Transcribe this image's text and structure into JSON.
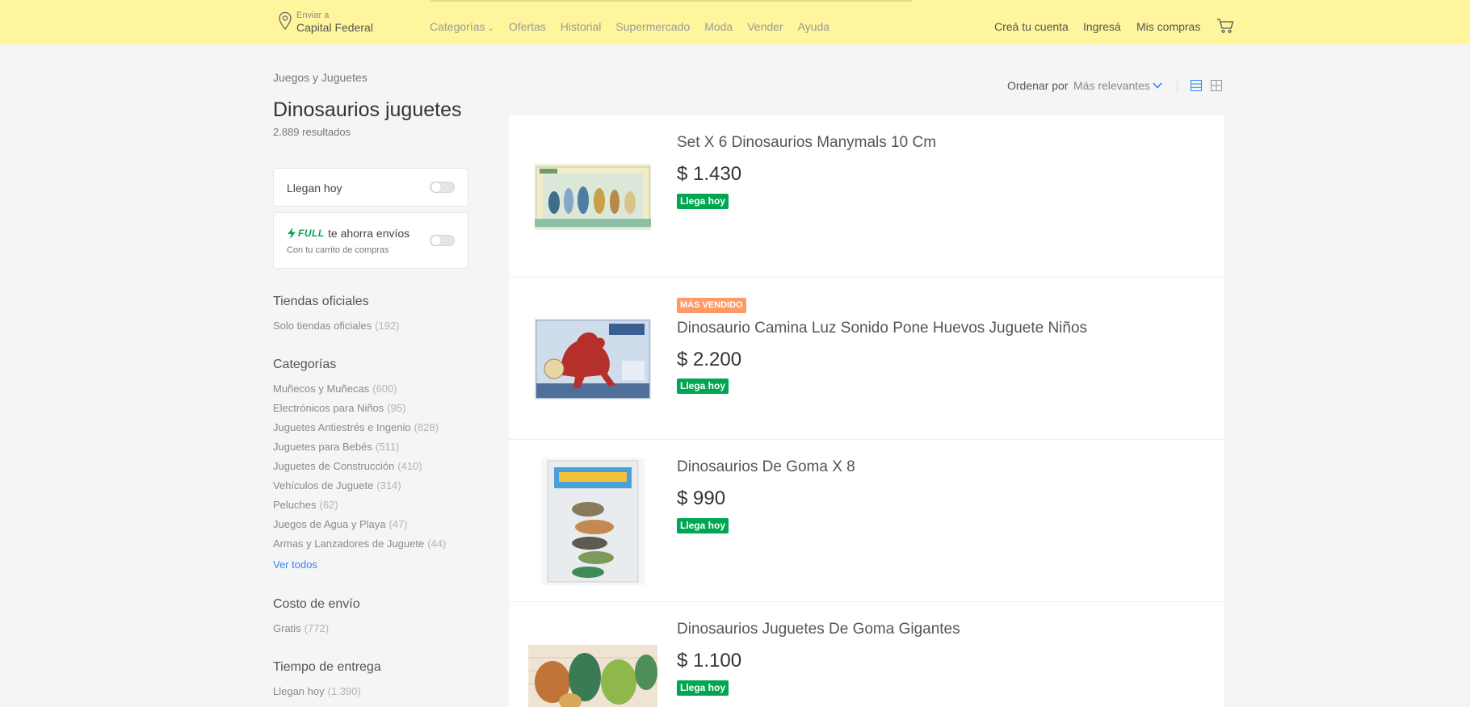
{
  "header": {
    "location_small": "Enviar a",
    "location_main": "Capital Federal",
    "nav": [
      "Categorías",
      "Ofertas",
      "Historial",
      "Supermercado",
      "Moda",
      "Vender",
      "Ayuda"
    ],
    "account": {
      "create": "Creá tu cuenta",
      "login": "Ingresá",
      "purchases": "Mis compras"
    }
  },
  "breadcrumb": "Juegos y Juguetes",
  "search": {
    "title": "Dinosaurios juguetes",
    "results": "2.889 resultados"
  },
  "filters": {
    "arrive_today": "Llegan hoy",
    "full_word": "FULL",
    "full_text": "te ahorra envíos",
    "full_sub": "Con tu carrito de compras",
    "official": {
      "title": "Tiendas oficiales",
      "label": "Solo tiendas oficiales",
      "count": "(192)"
    },
    "categories": {
      "title": "Categorías",
      "items": [
        {
          "label": "Muñecos y Muñecas",
          "count": "(600)"
        },
        {
          "label": "Electrónicos para Niños",
          "count": "(95)"
        },
        {
          "label": "Juguetes Antiestrés e Ingenio",
          "count": "(828)"
        },
        {
          "label": "Juguetes para Bebés",
          "count": "(511)"
        },
        {
          "label": "Juguetes de Construcción",
          "count": "(410)"
        },
        {
          "label": "Vehículos de Juguete",
          "count": "(314)"
        },
        {
          "label": "Peluches",
          "count": "(62)"
        },
        {
          "label": "Juegos de Agua y Playa",
          "count": "(47)"
        },
        {
          "label": "Armas y Lanzadores de Juguete",
          "count": "(44)"
        }
      ],
      "see_all": "Ver todos"
    },
    "shipping": {
      "title": "Costo de envío",
      "label": "Gratis",
      "count": "(772)"
    },
    "delivery": {
      "title": "Tiempo de entrega",
      "label": "Llegan hoy",
      "count": "(1.390)"
    }
  },
  "sort": {
    "label": "Ordenar por",
    "value": "Más relevantes"
  },
  "products": [
    {
      "title": "Set X 6 Dinosaurios Manymals 10 Cm",
      "price": "$ 1.430",
      "badge": "Llega hoy"
    },
    {
      "title": "Dinosaurio Camina Luz Sonido Pone Huevos Juguete Niños",
      "price": "$ 2.200",
      "badge": "Llega hoy",
      "best": "MÁS VENDIDO"
    },
    {
      "title": "Dinosaurios De Goma X 8",
      "price": "$ 990",
      "badge": "Llega hoy"
    },
    {
      "title": "Dinosaurios Juguetes De Goma Gigantes",
      "price": "$ 1.100",
      "badge": "Llega hoy"
    }
  ],
  "colors": {
    "header_bg": "#fff59d",
    "badge_green": "#00a650",
    "link_blue": "#3483fa",
    "best_seller": "#ff7733"
  }
}
